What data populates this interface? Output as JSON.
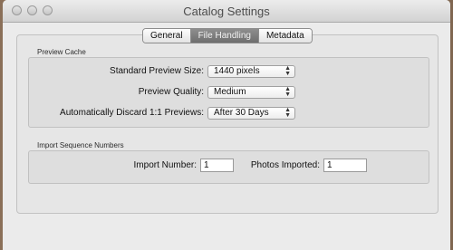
{
  "window": {
    "title": "Catalog Settings"
  },
  "tabs": [
    {
      "label": "General"
    },
    {
      "label": "File Handling",
      "active": true
    },
    {
      "label": "Metadata"
    }
  ],
  "preview_cache": {
    "section_title": "Preview Cache",
    "standard_preview_size": {
      "label": "Standard Preview Size:",
      "value": "1440 pixels"
    },
    "preview_quality": {
      "label": "Preview Quality:",
      "value": "Medium"
    },
    "discard_previews": {
      "label": "Automatically Discard 1:1 Previews:",
      "value": "After 30 Days"
    }
  },
  "import_sequence": {
    "section_title": "Import Sequence Numbers",
    "import_number": {
      "label": "Import Number:",
      "value": "1"
    },
    "photos_imported": {
      "label": "Photos Imported:",
      "value": "1"
    }
  },
  "icons": {
    "select_arrows": "up-down-arrows-icon"
  }
}
